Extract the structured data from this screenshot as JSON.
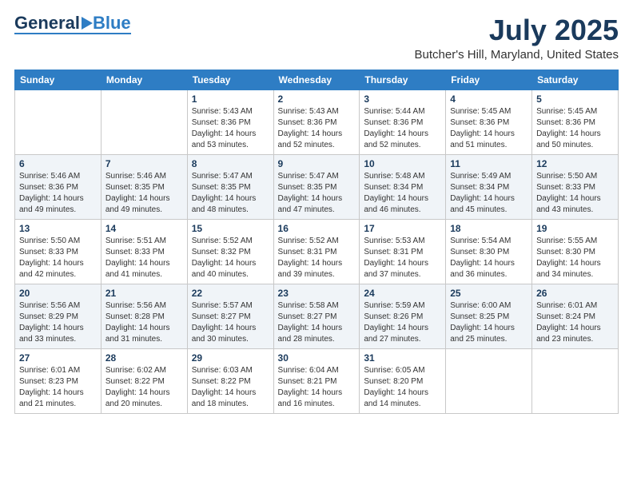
{
  "header": {
    "logo_general": "General",
    "logo_blue": "Blue",
    "month_year": "July 2025",
    "location": "Butcher's Hill, Maryland, United States"
  },
  "weekdays": [
    "Sunday",
    "Monday",
    "Tuesday",
    "Wednesday",
    "Thursday",
    "Friday",
    "Saturday"
  ],
  "weeks": [
    [
      {
        "day": "",
        "info": ""
      },
      {
        "day": "",
        "info": ""
      },
      {
        "day": "1",
        "info": "Sunrise: 5:43 AM\nSunset: 8:36 PM\nDaylight: 14 hours\nand 53 minutes."
      },
      {
        "day": "2",
        "info": "Sunrise: 5:43 AM\nSunset: 8:36 PM\nDaylight: 14 hours\nand 52 minutes."
      },
      {
        "day": "3",
        "info": "Sunrise: 5:44 AM\nSunset: 8:36 PM\nDaylight: 14 hours\nand 52 minutes."
      },
      {
        "day": "4",
        "info": "Sunrise: 5:45 AM\nSunset: 8:36 PM\nDaylight: 14 hours\nand 51 minutes."
      },
      {
        "day": "5",
        "info": "Sunrise: 5:45 AM\nSunset: 8:36 PM\nDaylight: 14 hours\nand 50 minutes."
      }
    ],
    [
      {
        "day": "6",
        "info": "Sunrise: 5:46 AM\nSunset: 8:36 PM\nDaylight: 14 hours\nand 49 minutes."
      },
      {
        "day": "7",
        "info": "Sunrise: 5:46 AM\nSunset: 8:35 PM\nDaylight: 14 hours\nand 49 minutes."
      },
      {
        "day": "8",
        "info": "Sunrise: 5:47 AM\nSunset: 8:35 PM\nDaylight: 14 hours\nand 48 minutes."
      },
      {
        "day": "9",
        "info": "Sunrise: 5:47 AM\nSunset: 8:35 PM\nDaylight: 14 hours\nand 47 minutes."
      },
      {
        "day": "10",
        "info": "Sunrise: 5:48 AM\nSunset: 8:34 PM\nDaylight: 14 hours\nand 46 minutes."
      },
      {
        "day": "11",
        "info": "Sunrise: 5:49 AM\nSunset: 8:34 PM\nDaylight: 14 hours\nand 45 minutes."
      },
      {
        "day": "12",
        "info": "Sunrise: 5:50 AM\nSunset: 8:33 PM\nDaylight: 14 hours\nand 43 minutes."
      }
    ],
    [
      {
        "day": "13",
        "info": "Sunrise: 5:50 AM\nSunset: 8:33 PM\nDaylight: 14 hours\nand 42 minutes."
      },
      {
        "day": "14",
        "info": "Sunrise: 5:51 AM\nSunset: 8:33 PM\nDaylight: 14 hours\nand 41 minutes."
      },
      {
        "day": "15",
        "info": "Sunrise: 5:52 AM\nSunset: 8:32 PM\nDaylight: 14 hours\nand 40 minutes."
      },
      {
        "day": "16",
        "info": "Sunrise: 5:52 AM\nSunset: 8:31 PM\nDaylight: 14 hours\nand 39 minutes."
      },
      {
        "day": "17",
        "info": "Sunrise: 5:53 AM\nSunset: 8:31 PM\nDaylight: 14 hours\nand 37 minutes."
      },
      {
        "day": "18",
        "info": "Sunrise: 5:54 AM\nSunset: 8:30 PM\nDaylight: 14 hours\nand 36 minutes."
      },
      {
        "day": "19",
        "info": "Sunrise: 5:55 AM\nSunset: 8:30 PM\nDaylight: 14 hours\nand 34 minutes."
      }
    ],
    [
      {
        "day": "20",
        "info": "Sunrise: 5:56 AM\nSunset: 8:29 PM\nDaylight: 14 hours\nand 33 minutes."
      },
      {
        "day": "21",
        "info": "Sunrise: 5:56 AM\nSunset: 8:28 PM\nDaylight: 14 hours\nand 31 minutes."
      },
      {
        "day": "22",
        "info": "Sunrise: 5:57 AM\nSunset: 8:27 PM\nDaylight: 14 hours\nand 30 minutes."
      },
      {
        "day": "23",
        "info": "Sunrise: 5:58 AM\nSunset: 8:27 PM\nDaylight: 14 hours\nand 28 minutes."
      },
      {
        "day": "24",
        "info": "Sunrise: 5:59 AM\nSunset: 8:26 PM\nDaylight: 14 hours\nand 27 minutes."
      },
      {
        "day": "25",
        "info": "Sunrise: 6:00 AM\nSunset: 8:25 PM\nDaylight: 14 hours\nand 25 minutes."
      },
      {
        "day": "26",
        "info": "Sunrise: 6:01 AM\nSunset: 8:24 PM\nDaylight: 14 hours\nand 23 minutes."
      }
    ],
    [
      {
        "day": "27",
        "info": "Sunrise: 6:01 AM\nSunset: 8:23 PM\nDaylight: 14 hours\nand 21 minutes."
      },
      {
        "day": "28",
        "info": "Sunrise: 6:02 AM\nSunset: 8:22 PM\nDaylight: 14 hours\nand 20 minutes."
      },
      {
        "day": "29",
        "info": "Sunrise: 6:03 AM\nSunset: 8:22 PM\nDaylight: 14 hours\nand 18 minutes."
      },
      {
        "day": "30",
        "info": "Sunrise: 6:04 AM\nSunset: 8:21 PM\nDaylight: 14 hours\nand 16 minutes."
      },
      {
        "day": "31",
        "info": "Sunrise: 6:05 AM\nSunset: 8:20 PM\nDaylight: 14 hours\nand 14 minutes."
      },
      {
        "day": "",
        "info": ""
      },
      {
        "day": "",
        "info": ""
      }
    ]
  ]
}
